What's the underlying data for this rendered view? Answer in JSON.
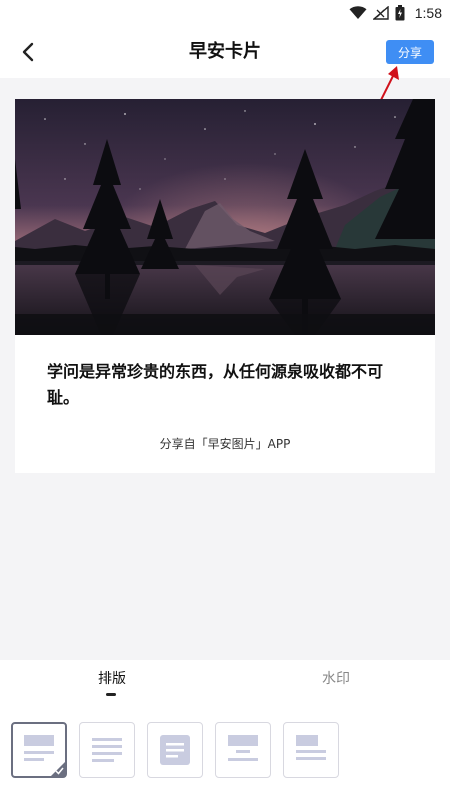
{
  "status_bar": {
    "time": "1:58"
  },
  "header": {
    "title": "早安卡片",
    "share_label": "分享"
  },
  "card": {
    "quote": "学问是异常珍贵的东西，从任何源泉吸收都不可耻。",
    "share_source": "分享自「早安图片」APP"
  },
  "tabs": [
    {
      "label": "排版",
      "active": true
    },
    {
      "label": "水印",
      "active": false
    }
  ],
  "layout_options": [
    {
      "icon": "layout-image-top-icon",
      "selected": true
    },
    {
      "icon": "layout-text-lines-icon",
      "selected": false
    },
    {
      "icon": "layout-text-box-icon",
      "selected": false
    },
    {
      "icon": "layout-image-center-icon",
      "selected": false
    },
    {
      "icon": "layout-image-left-icon",
      "selected": false
    }
  ],
  "colors": {
    "accent": "#3f8ef4",
    "annotation": "#d0111b",
    "thumb_fill": "#c9cce0"
  }
}
